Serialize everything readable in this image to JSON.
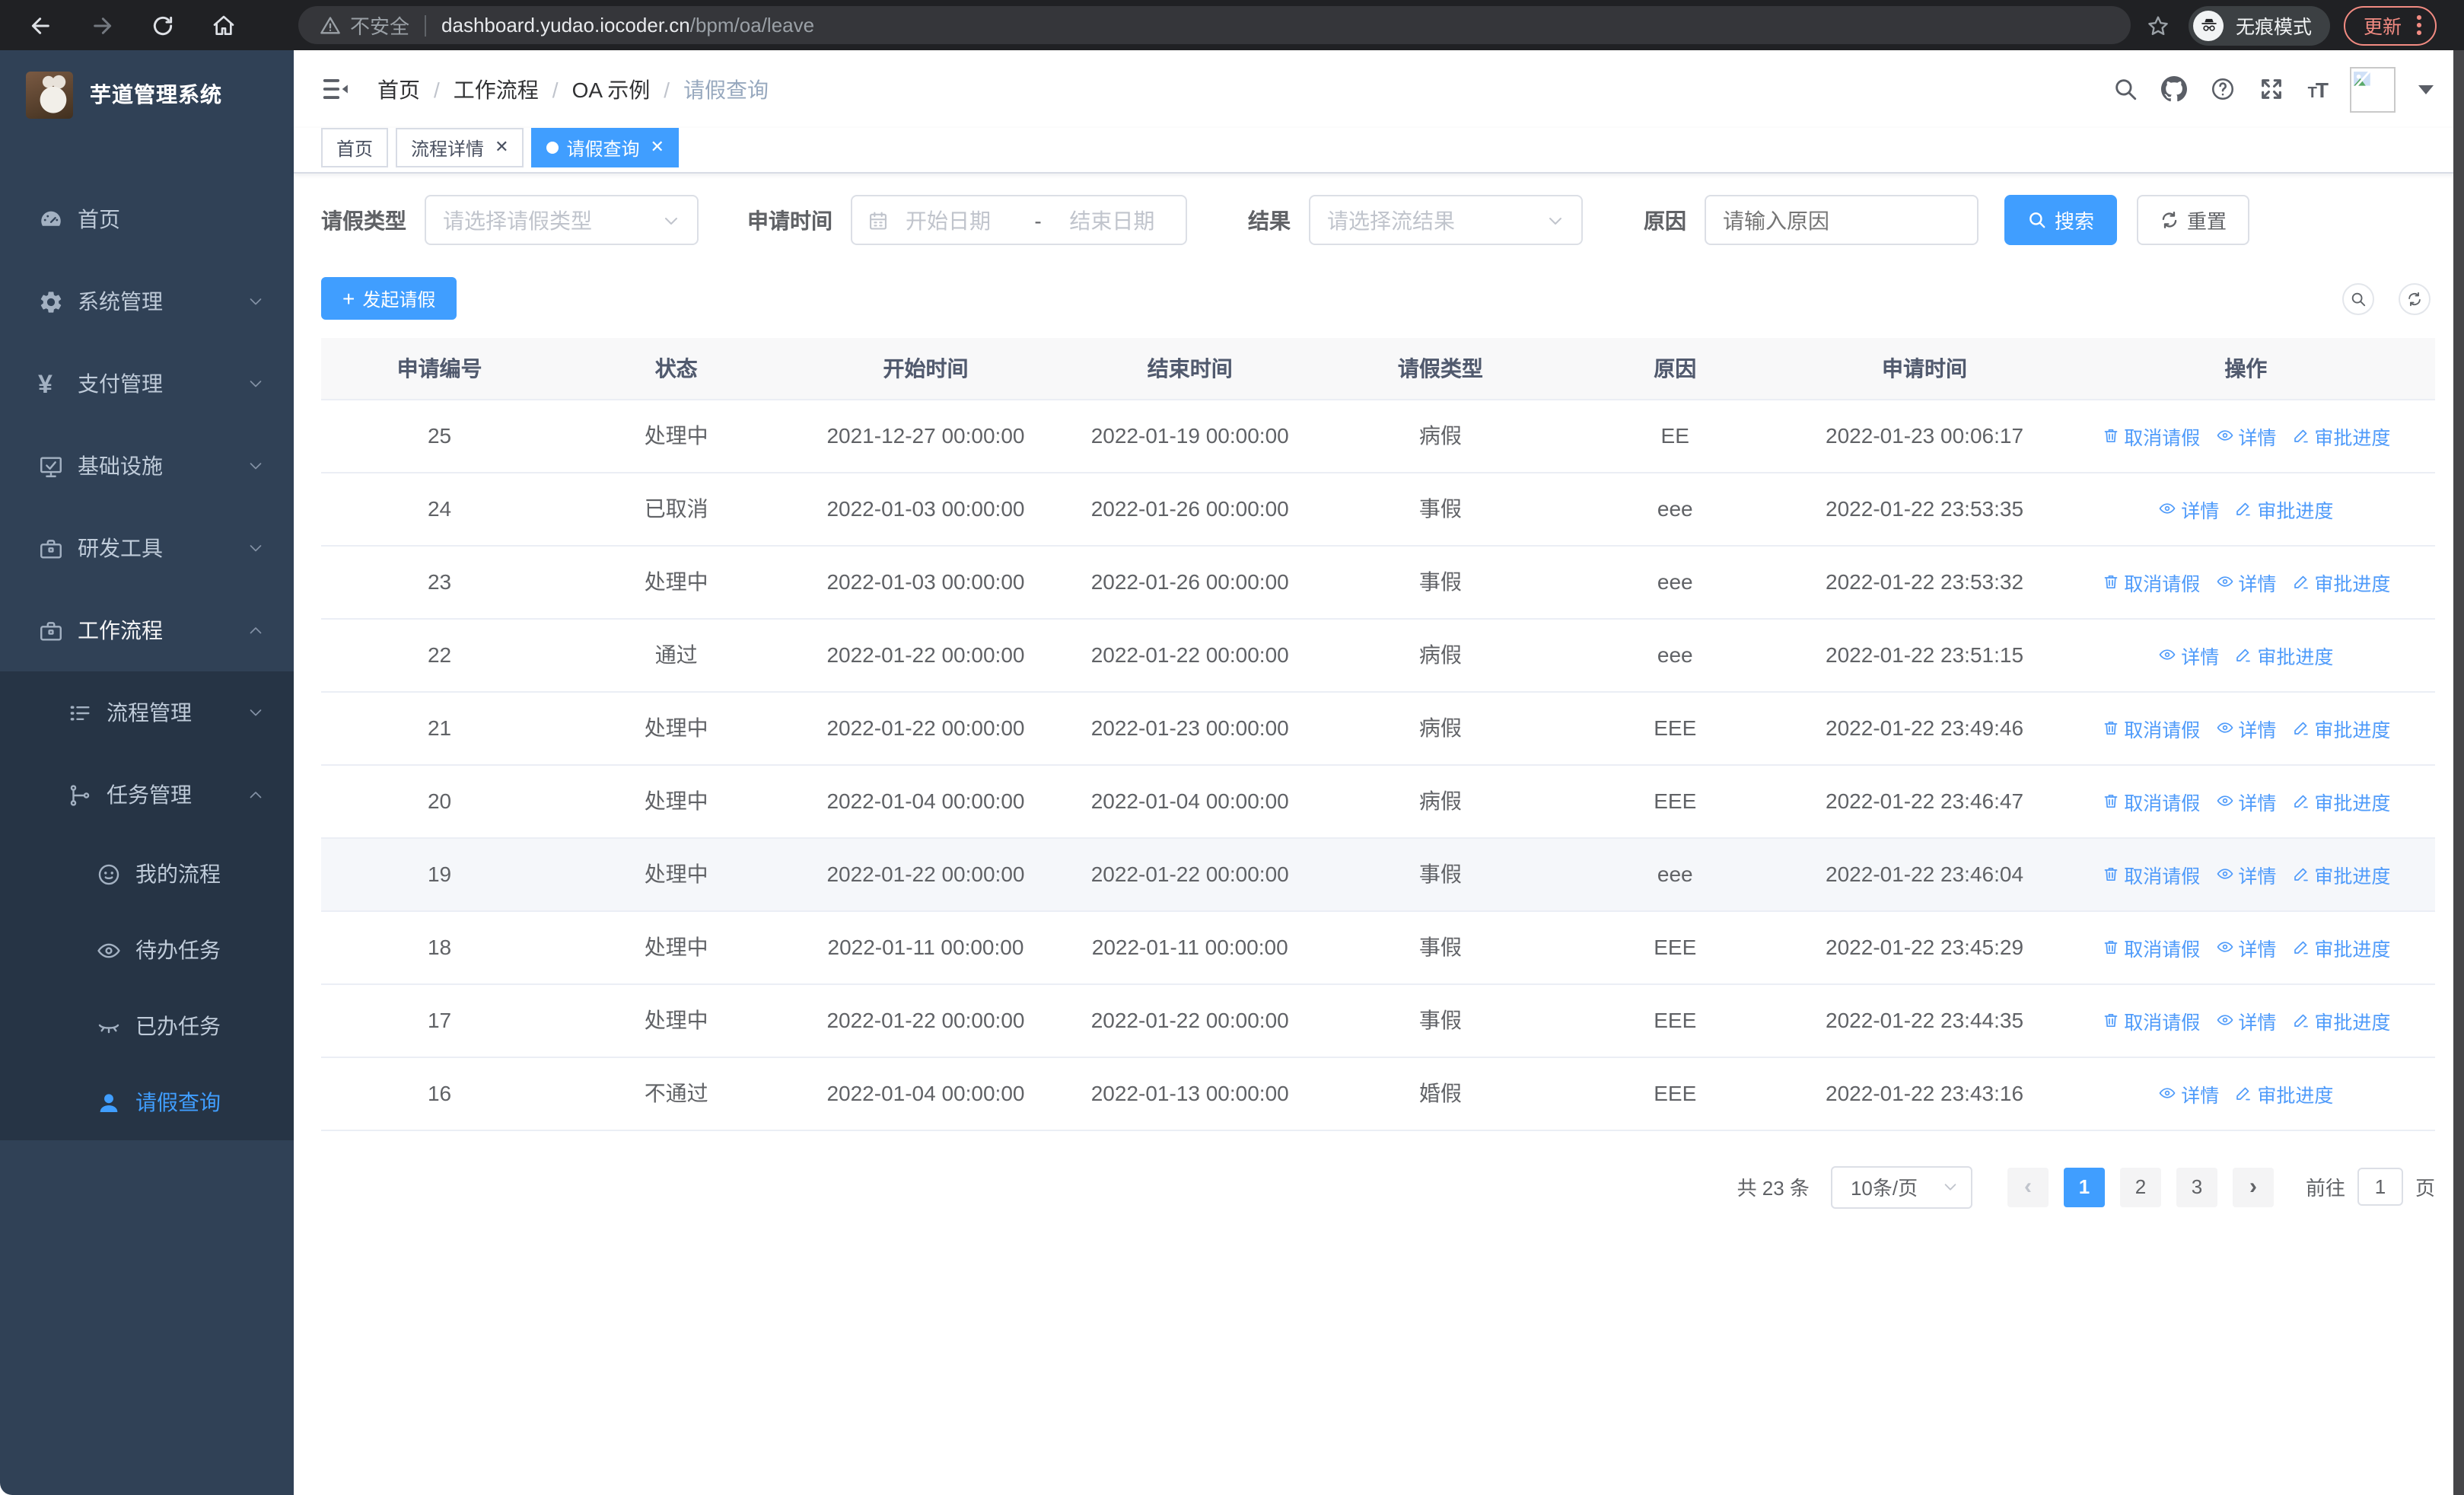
{
  "browser": {
    "security_label": "不安全",
    "url_host": "dashboard.yudao.iocoder.cn",
    "url_path": "/bpm/oa/leave",
    "incognito_label": "无痕模式",
    "update_label": "更新"
  },
  "sidebar": {
    "app_title": "芋道管理系统",
    "items": [
      {
        "name": "home",
        "label": "首页",
        "icon": "dashboard-icon",
        "level": 0
      },
      {
        "name": "system-management",
        "label": "系统管理",
        "icon": "gear-icon",
        "level": 0,
        "chevron": "down"
      },
      {
        "name": "payment-management",
        "label": "支付管理",
        "icon": "yen-icon",
        "level": 0,
        "chevron": "down"
      },
      {
        "name": "infrastructure",
        "label": "基础设施",
        "icon": "monitor-icon",
        "level": 0,
        "chevron": "down"
      },
      {
        "name": "dev-tools",
        "label": "研发工具",
        "icon": "toolbox-icon",
        "level": 0,
        "chevron": "down"
      },
      {
        "name": "workflow",
        "label": "工作流程",
        "icon": "toolbox-icon",
        "level": 0,
        "chevron": "up",
        "highlight": true
      },
      {
        "name": "process-management",
        "label": "流程管理",
        "icon": "list-icon",
        "level": 1,
        "chevron": "down",
        "in_submenu": true
      },
      {
        "name": "task-management",
        "label": "任务管理",
        "icon": "tree-icon",
        "level": 1,
        "chevron": "up",
        "in_submenu": true
      },
      {
        "name": "my-processes",
        "label": "我的流程",
        "icon": "face-icon",
        "level": 2,
        "in_submenu": true
      },
      {
        "name": "todo-tasks",
        "label": "待办任务",
        "icon": "eye-icon",
        "level": 2,
        "in_submenu": true
      },
      {
        "name": "done-tasks",
        "label": "已办任务",
        "icon": "eye-closed-icon",
        "level": 2,
        "in_submenu": true
      },
      {
        "name": "leave-query",
        "label": "请假查询",
        "icon": "user-icon",
        "level": 2,
        "in_submenu": true,
        "active": true
      }
    ]
  },
  "breadcrumb": [
    "首页",
    "工作流程",
    "OA 示例",
    "请假查询"
  ],
  "tabs": [
    {
      "label": "首页",
      "closable": false,
      "active": false
    },
    {
      "label": "流程详情",
      "closable": true,
      "active": false
    },
    {
      "label": "请假查询",
      "closable": true,
      "active": true
    }
  ],
  "filters": {
    "leave_type_label": "请假类型",
    "leave_type_placeholder": "请选择请假类型",
    "apply_time_label": "申请时间",
    "start_date_placeholder": "开始日期",
    "range_separator": "-",
    "end_date_placeholder": "结束日期",
    "result_label": "结果",
    "result_placeholder": "请选择流结果",
    "reason_label": "原因",
    "reason_placeholder": "请输入原因",
    "search_label": "搜索",
    "reset_label": "重置"
  },
  "toolbar": {
    "create_label": "发起请假"
  },
  "table": {
    "columns": [
      "申请编号",
      "状态",
      "开始时间",
      "结束时间",
      "请假类型",
      "原因",
      "申请时间",
      "操作"
    ],
    "actions_def": {
      "cancel": {
        "label": "取消请假",
        "icon": "trash-icon"
      },
      "detail": {
        "label": "详情",
        "icon": "eye-icon"
      },
      "progress": {
        "label": "审批进度",
        "icon": "pen-icon"
      }
    },
    "rows": [
      {
        "id": "25",
        "status": "处理中",
        "start": "2021-12-27 00:00:00",
        "end": "2022-01-19 00:00:00",
        "type": "病假",
        "reason": "EE",
        "applied": "2022-01-23 00:06:17",
        "actions": [
          "cancel",
          "detail",
          "progress"
        ],
        "hovered": false
      },
      {
        "id": "24",
        "status": "已取消",
        "start": "2022-01-03 00:00:00",
        "end": "2022-01-26 00:00:00",
        "type": "事假",
        "reason": "eee",
        "applied": "2022-01-22 23:53:35",
        "actions": [
          "detail",
          "progress"
        ],
        "hovered": false
      },
      {
        "id": "23",
        "status": "处理中",
        "start": "2022-01-03 00:00:00",
        "end": "2022-01-26 00:00:00",
        "type": "事假",
        "reason": "eee",
        "applied": "2022-01-22 23:53:32",
        "actions": [
          "cancel",
          "detail",
          "progress"
        ],
        "hovered": false
      },
      {
        "id": "22",
        "status": "通过",
        "start": "2022-01-22 00:00:00",
        "end": "2022-01-22 00:00:00",
        "type": "病假",
        "reason": "eee",
        "applied": "2022-01-22 23:51:15",
        "actions": [
          "detail",
          "progress"
        ],
        "hovered": false
      },
      {
        "id": "21",
        "status": "处理中",
        "start": "2022-01-22 00:00:00",
        "end": "2022-01-23 00:00:00",
        "type": "病假",
        "reason": "EEE",
        "applied": "2022-01-22 23:49:46",
        "actions": [
          "cancel",
          "detail",
          "progress"
        ],
        "hovered": false
      },
      {
        "id": "20",
        "status": "处理中",
        "start": "2022-01-04 00:00:00",
        "end": "2022-01-04 00:00:00",
        "type": "病假",
        "reason": "EEE",
        "applied": "2022-01-22 23:46:47",
        "actions": [
          "cancel",
          "detail",
          "progress"
        ],
        "hovered": false
      },
      {
        "id": "19",
        "status": "处理中",
        "start": "2022-01-22 00:00:00",
        "end": "2022-01-22 00:00:00",
        "type": "事假",
        "reason": "eee",
        "applied": "2022-01-22 23:46:04",
        "actions": [
          "cancel",
          "detail",
          "progress"
        ],
        "hovered": true
      },
      {
        "id": "18",
        "status": "处理中",
        "start": "2022-01-11 00:00:00",
        "end": "2022-01-11 00:00:00",
        "type": "事假",
        "reason": "EEE",
        "applied": "2022-01-22 23:45:29",
        "actions": [
          "cancel",
          "detail",
          "progress"
        ],
        "hovered": false
      },
      {
        "id": "17",
        "status": "处理中",
        "start": "2022-01-22 00:00:00",
        "end": "2022-01-22 00:00:00",
        "type": "事假",
        "reason": "EEE",
        "applied": "2022-01-22 23:44:35",
        "actions": [
          "cancel",
          "detail",
          "progress"
        ],
        "hovered": false
      },
      {
        "id": "16",
        "status": "不通过",
        "start": "2022-01-04 00:00:00",
        "end": "2022-01-13 00:00:00",
        "type": "婚假",
        "reason": "EEE",
        "applied": "2022-01-22 23:43:16",
        "actions": [
          "detail",
          "progress"
        ],
        "hovered": false
      }
    ]
  },
  "pagination": {
    "total_label": "共 23 条",
    "page_size": "10条/页",
    "prev_symbol": "‹",
    "next_symbol": "›",
    "pages": [
      "1",
      "2",
      "3"
    ],
    "active_page": "1",
    "goto_label": "前往",
    "goto_value": "1",
    "page_suffix": "页"
  },
  "colors": {
    "primary": "#409eff",
    "sidebar_bg": "#304156",
    "submenu_bg": "#263445",
    "link_blue": "#4f9bfa",
    "update_accent": "#f28b82"
  }
}
